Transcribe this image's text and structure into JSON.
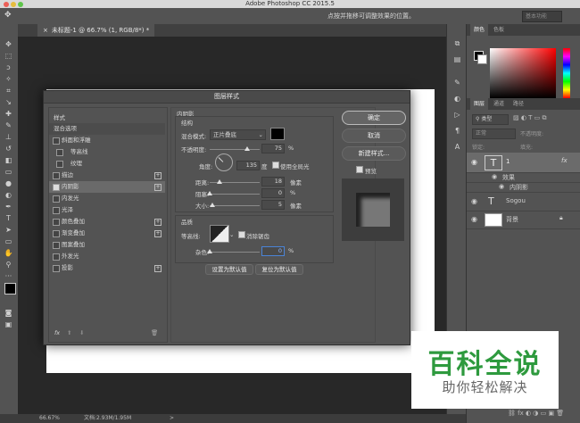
{
  "app": {
    "title": "Adobe Photoshop CC 2015.5"
  },
  "options": {
    "hint": "点按并拖移可调整效果的位置。",
    "workspace": "基本功能"
  },
  "document": {
    "tab_label": "未标题-1 @ 66.7% (1, RGB/8*) *",
    "close": "×"
  },
  "status": {
    "zoom": "66.67%",
    "doc_size": "文档:2.93M/1.95M",
    "arrow": ">"
  },
  "dialog": {
    "title": "图层样式",
    "styles_header": "样式",
    "blend_options": "混合选项",
    "style_items": [
      {
        "label": "斜面和浮雕",
        "checked": false
      },
      {
        "label": "等高线",
        "checked": false
      },
      {
        "label": "纹理",
        "checked": false
      },
      {
        "label": "描边",
        "checked": false
      },
      {
        "label": "内阴影",
        "checked": true
      },
      {
        "label": "内发光",
        "checked": false
      },
      {
        "label": "光泽",
        "checked": false
      },
      {
        "label": "颜色叠加",
        "checked": false
      },
      {
        "label": "渐变叠加",
        "checked": false
      },
      {
        "label": "图案叠加",
        "checked": false
      },
      {
        "label": "外发光",
        "checked": false
      },
      {
        "label": "投影",
        "checked": false
      }
    ],
    "fx_label": "fx",
    "section_title": "内阴影",
    "structure_title": "结构",
    "blend_mode_label": "混合模式:",
    "blend_mode_value": "正片叠底",
    "opacity_label": "不透明度:",
    "opacity_value": "75",
    "opacity_fraction": 0.75,
    "angle_label": "角度:",
    "angle_value": "135",
    "angle_unit": "度",
    "global_light_label": "使用全局光",
    "distance_label": "距离:",
    "distance_value": "18",
    "distance_unit": "像素",
    "choke_label": "阻塞:",
    "choke_value": "0",
    "size_label": "大小:",
    "size_value": "5",
    "size_unit": "像素",
    "percent": "%",
    "quality_title": "品质",
    "contour_label": "等高线:",
    "antialias_label": "消除锯齿",
    "noise_label": "杂色:",
    "noise_value": "0",
    "set_default": "设置为默认值",
    "reset_default": "复位为默认值",
    "ok": "确定",
    "cancel": "取消",
    "new_style": "新建样式...",
    "preview": "预览"
  },
  "panels": {
    "top_tabs": [
      "颜色",
      "色板"
    ],
    "layer_tabs": [
      "图层",
      "通道",
      "路径"
    ],
    "kind_label": "类型",
    "blend_label": "正常",
    "lock_label": "锁定:",
    "opacity_label": "不透明度:",
    "fill_label": "填充:",
    "layers": [
      {
        "name": "1",
        "type": "text",
        "fx": "fx"
      },
      {
        "name": "效果",
        "type": "effects-group"
      },
      {
        "name": "内阴影",
        "type": "effect"
      },
      {
        "name": "Sogou",
        "type": "text"
      },
      {
        "name": "背景",
        "type": "background"
      }
    ]
  },
  "watermark": {
    "title": "百科全说",
    "subtitle": "助你轻松解决"
  }
}
